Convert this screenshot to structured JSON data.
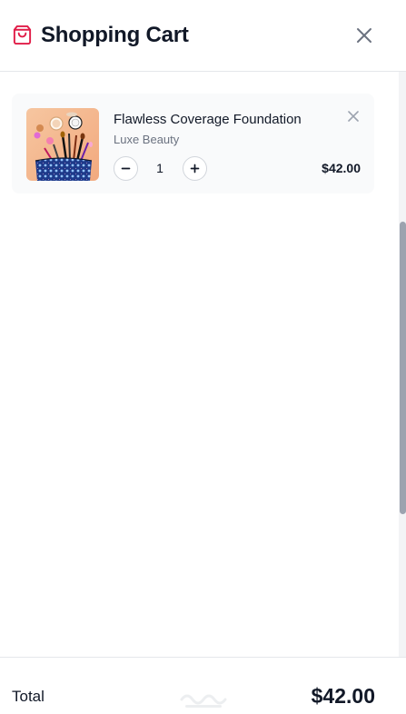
{
  "header": {
    "title": "Shopping Cart",
    "cart_icon": "shopping-bag-icon",
    "close_icon": "close-icon"
  },
  "cart": {
    "items": [
      {
        "name": "Flawless Coverage Foundation",
        "brand": "Luxe Beauty",
        "quantity": "1",
        "price": "$42.00",
        "image": "makeup-products-photo"
      }
    ]
  },
  "footer": {
    "total_label": "Total",
    "total_value": "$42.00"
  },
  "colors": {
    "accent": "#e11d48",
    "text": "#111827",
    "muted": "#6b7280",
    "card_bg": "#f9fafb",
    "border": "#e5e7eb"
  }
}
